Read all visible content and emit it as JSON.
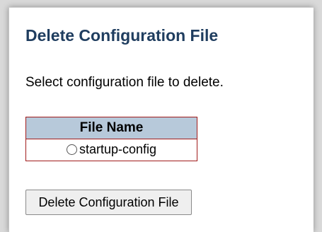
{
  "page": {
    "title": "Delete Configuration File",
    "intro": "Select configuration file to delete."
  },
  "file_table": {
    "header": "File Name",
    "rows": [
      {
        "name": "startup-config",
        "selected": false
      }
    ]
  },
  "actions": {
    "delete_label": "Delete Configuration File"
  },
  "colors": {
    "title_text": "#1f3d5f",
    "table_header_bg": "#b7c9da",
    "table_border": "#a11b1b",
    "button_bg": "#efefef"
  },
  "icons": {
    "row_selector": "radio-button-icon"
  }
}
